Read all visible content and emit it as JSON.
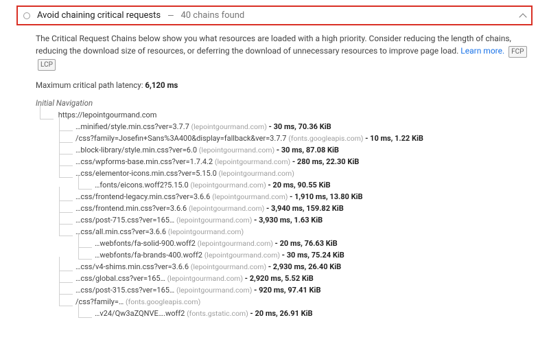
{
  "header": {
    "title": "Avoid chaining critical requests",
    "subtitle": "40 chains found"
  },
  "description": {
    "text1": "The Critical Request Chains below show you what resources are loaded with a high priority. Consider reducing the length of chains, reducing the download size of resources, or deferring the download of unnecessary resources to improve page load.",
    "learn_more": "Learn more.",
    "chip1": "FCP",
    "chip2": "LCP"
  },
  "latency": {
    "label": "Maximum critical path latency:",
    "value": "6,120 ms"
  },
  "nav": {
    "label": "Initial Navigation",
    "root": "https://lepointgourmand.com"
  },
  "rows": [
    {
      "depth": 1,
      "url": "…minified/style.min.css?ver=3.7.7",
      "domain": "(lepointgourmand.com)",
      "stats": "- 30 ms, 70.36 KiB"
    },
    {
      "depth": 1,
      "url": "/css?family=Josefin+Sans%3A400&display=fallback&ver=3.7.7",
      "domain": "(fonts.googleapis.com)",
      "stats": "- 10 ms, 1.22 KiB"
    },
    {
      "depth": 1,
      "url": "…block-library/style.min.css?ver=6.0",
      "domain": "(lepointgourmand.com)",
      "stats": "- 30 ms, 87.08 KiB"
    },
    {
      "depth": 1,
      "url": "…css/wpforms-base.min.css?ver=1.7.4.2",
      "domain": "(lepointgourmand.com)",
      "stats": "- 280 ms, 22.30 KiB"
    },
    {
      "depth": 1,
      "url": "…css/elementor-icons.min.css?ver=5.15.0",
      "domain": "(lepointgourmand.com)",
      "stats": ""
    },
    {
      "depth": 2,
      "url": "…fonts/eicons.woff2?5.15.0",
      "domain": "(lepointgourmand.com)",
      "stats": "- 20 ms, 90.55 KiB"
    },
    {
      "depth": 1,
      "url": "…css/frontend-legacy.min.css?ver=3.6.6",
      "domain": "(lepointgourmand.com)",
      "stats": "- 1,910 ms, 13.80 KiB"
    },
    {
      "depth": 1,
      "url": "…css/frontend.min.css?ver=3.6.6",
      "domain": "(lepointgourmand.com)",
      "stats": "- 3,940 ms, 159.82 KiB"
    },
    {
      "depth": 1,
      "url": "…css/post-715.css?ver=165…",
      "domain": "(lepointgourmand.com)",
      "stats": "- 3,930 ms, 1.63 KiB"
    },
    {
      "depth": 1,
      "url": "…css/all.min.css?ver=3.6.6",
      "domain": "(lepointgourmand.com)",
      "stats": ""
    },
    {
      "depth": 2,
      "url": "…webfonts/fa-solid-900.woff2",
      "domain": "(lepointgourmand.com)",
      "stats": "- 20 ms, 76.63 KiB"
    },
    {
      "depth": 2,
      "url": "…webfonts/fa-brands-400.woff2",
      "domain": "(lepointgourmand.com)",
      "stats": "- 30 ms, 75.24 KiB"
    },
    {
      "depth": 1,
      "url": "…css/v4-shims.min.css?ver=3.6.6",
      "domain": "(lepointgourmand.com)",
      "stats": "- 2,930 ms, 26.40 KiB"
    },
    {
      "depth": 1,
      "url": "…css/global.css?ver=165…",
      "domain": "(lepointgourmand.com)",
      "stats": "- 2,920 ms, 5.52 KiB"
    },
    {
      "depth": 1,
      "url": "…css/post-315.css?ver=165…",
      "domain": "(lepointgourmand.com)",
      "stats": "- 920 ms, 97.41 KiB"
    },
    {
      "depth": 1,
      "url": "/css?family=…",
      "domain": "(fonts.googleapis.com)",
      "stats": ""
    },
    {
      "depth": 2,
      "url": "…v24/Qw3aZQNVE….woff2",
      "domain": "(fonts.gstatic.com)",
      "stats": "- 20 ms, 26.91 KiB"
    }
  ]
}
